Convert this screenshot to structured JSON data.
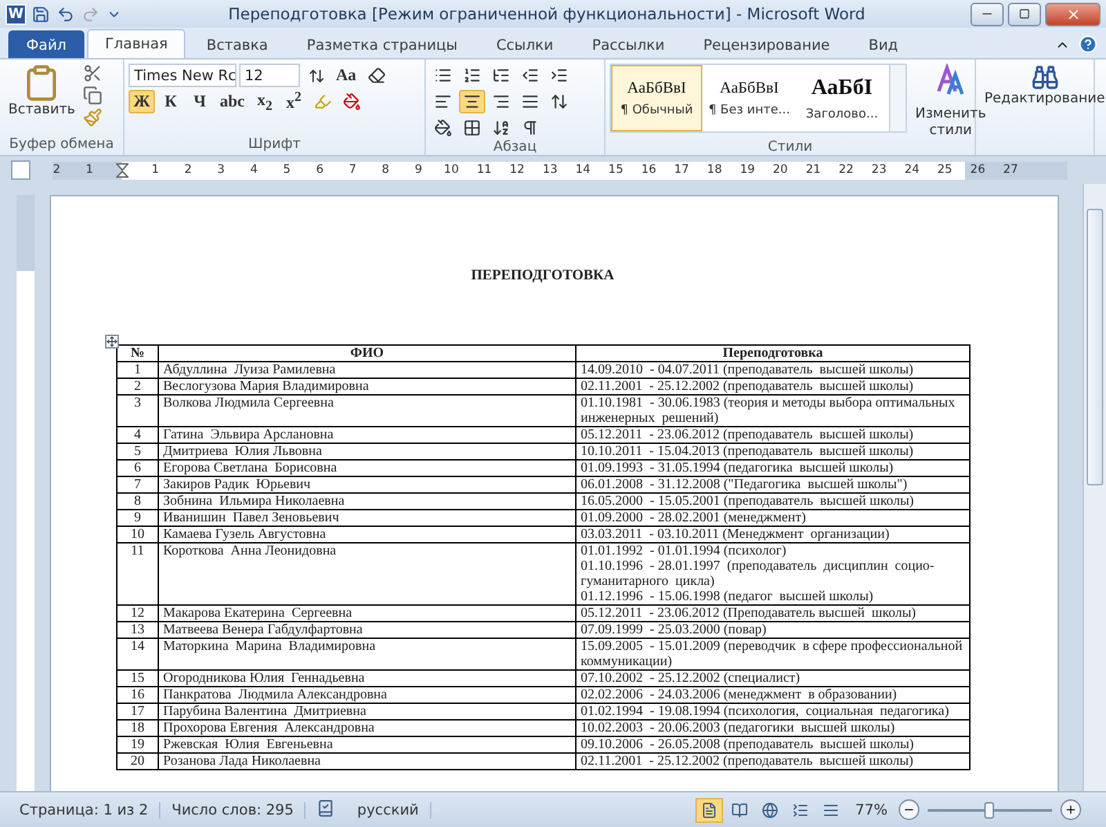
{
  "window": {
    "logo": "W",
    "title": "Переподготовка [Режим ограниченной функциональности]  -  Microsoft Word"
  },
  "tabs": [
    {
      "label": "Файл",
      "kind": "file",
      "selected": false
    },
    {
      "label": "Главная",
      "kind": "tab",
      "selected": true
    },
    {
      "label": "Вставка",
      "kind": "tab",
      "selected": false
    },
    {
      "label": "Разметка страницы",
      "kind": "tab",
      "selected": false
    },
    {
      "label": "Ссылки",
      "kind": "tab",
      "selected": false
    },
    {
      "label": "Рассылки",
      "kind": "tab",
      "selected": false
    },
    {
      "label": "Рецензирование",
      "kind": "tab",
      "selected": false
    },
    {
      "label": "Вид",
      "kind": "tab",
      "selected": false
    }
  ],
  "ribbon": {
    "clipboard": {
      "paste_label": "Вставить",
      "group_label": "Буфер обмена"
    },
    "font": {
      "font_name": "Times New Rc",
      "font_size": "12",
      "change_case": "Aa",
      "group_label": "Шрифт",
      "format_buttons": [
        {
          "label": "Ж",
          "selected": true
        },
        {
          "label": "К",
          "selected": false
        },
        {
          "label": "Ч",
          "selected": false
        },
        {
          "label": "abc",
          "selected": false
        },
        {
          "label": "x$_{2}$",
          "selected": false
        },
        {
          "label": "x$^{2}$",
          "selected": false
        }
      ]
    },
    "paragraph": {
      "group_label": "Абзац",
      "align": [
        {
          "kind": "left",
          "selected": false
        },
        {
          "kind": "center",
          "selected": true
        },
        {
          "kind": "right",
          "selected": false
        },
        {
          "kind": "justify",
          "selected": false
        }
      ]
    },
    "styles": {
      "group_label": "Стили",
      "items": [
        {
          "preview": "АаБбВвI",
          "label": "¶ Обычный",
          "selected": true
        },
        {
          "preview": "АаБбВвI",
          "label": "¶ Без инте...",
          "selected": false
        },
        {
          "preview": "АаБбI",
          "label": "Заголово...",
          "selected": false,
          "kind": "heading"
        }
      ],
      "change_styles": [
        "Изменить",
        "стили"
      ]
    },
    "editing": {
      "label": "Редактирование"
    }
  },
  "ruler": {
    "left_labels": [
      "2",
      "1"
    ],
    "labels": [
      "1",
      "2",
      "3",
      "4",
      "5",
      "6",
      "7",
      "8",
      "9",
      "10",
      "11",
      "12",
      "13",
      "14",
      "15",
      "16",
      "17",
      "18",
      "19",
      "20",
      "21",
      "22",
      "23",
      "24",
      "25",
      "26",
      "27"
    ]
  },
  "document": {
    "title": "ПЕРЕПОДГОТОВКА",
    "table": {
      "columns": [
        "№",
        "ФИО",
        "Переподготовка"
      ],
      "rows": [
        {
          "num": "1",
          "name": "Абдуллина  Луиза Рамилевна",
          "training": [
            "14.09.2010  - 04.07.2011 (преподаватель  высшей школы)"
          ]
        },
        {
          "num": "2",
          "name": "Веслогузова Мария Владимировна",
          "training": [
            "02.11.2001  - 25.12.2002 (преподаватель  высшей школы)"
          ]
        },
        {
          "num": "3",
          "name": "Волкова Людмила Сергеевна",
          "training": [
            "01.10.1981  - 30.06.1983 (теория и методы выбора оптимальных инженерных  решений)"
          ]
        },
        {
          "num": "4",
          "name": "Гатина  Эльвира Арслановна",
          "training": [
            "05.12.2011  - 23.06.2012 (преподаватель  высшей школы)"
          ]
        },
        {
          "num": "5",
          "name": "Дмитриева  Юлия Львовна",
          "training": [
            "10.10.2011  - 15.04.2013 (преподаватель  высшей школы)"
          ]
        },
        {
          "num": "6",
          "name": "Егорова Светлана  Борисовна",
          "training": [
            "01.09.1993  - 31.05.1994 (педагогика  высшей школы)"
          ]
        },
        {
          "num": "7",
          "name": "Закиров Радик  Юрьевич",
          "training": [
            "06.01.2008  - 31.12.2008 (\"Педагогика  высшей школы\")"
          ]
        },
        {
          "num": "8",
          "name": "Зобнина  Ильмира Николаевна",
          "training": [
            "16.05.2000  - 15.05.2001 (преподаватель  высшей школы)"
          ]
        },
        {
          "num": "9",
          "name": "Иванишин  Павел Зеновьевич",
          "training": [
            "01.09.2000  - 28.02.2001 (менеджмент)"
          ]
        },
        {
          "num": "10",
          "name": "Камаева Гузель Августовна",
          "training": [
            "03.03.2011  - 03.10.2011 (Менеджмент  организации)"
          ]
        },
        {
          "num": "11",
          "name": "Короткова  Анна Леонидовна",
          "training": [
            "01.01.1992  - 01.01.1994 (психолог)",
            "01.10.1996  - 28.01.1997  (преподаватель  дисциплин  социо-гуманитарного  цикла)",
            "01.12.1996  - 15.06.1998 (педагог  высшей школы)"
          ]
        },
        {
          "num": "12",
          "name": "Макарова Екатерина  Сергеевна",
          "training": [
            "05.12.2011  - 23.06.2012 (Преподаватель высшей  школы)"
          ]
        },
        {
          "num": "13",
          "name": "Матвеева Венера Габдулфартовна",
          "training": [
            "07.09.1999  - 25.03.2000 (повар)"
          ]
        },
        {
          "num": "14",
          "name": "Маторкина  Марина  Владимировна",
          "training": [
            "15.09.2005  - 15.01.2009 (переводчик  в сфере профессиональной коммуникации)"
          ]
        },
        {
          "num": "15",
          "name": "Огородникова Юлия  Геннадьевна",
          "training": [
            "07.10.2002  - 25.12.2002 (специалист)"
          ]
        },
        {
          "num": "16",
          "name": "Панкратова  Людмила Александровна",
          "training": [
            "02.02.2006  - 24.03.2006 (менеджмент  в образовании)"
          ]
        },
        {
          "num": "17",
          "name": "Парубина Валентина  Дмитриевна",
          "training": [
            "01.02.1994  - 19.08.1994 (психология,  социальная  педагогика)"
          ]
        },
        {
          "num": "18",
          "name": "Прохорова Евгения  Александровна",
          "training": [
            "10.02.2003  - 20.06.2003 (педагогики  высшей школы)"
          ]
        },
        {
          "num": "19",
          "name": "Ржевская  Юлия  Евгеньевна",
          "training": [
            "09.10.2006  - 26.05.2008 (преподаватель  высшей школы)"
          ]
        },
        {
          "num": "20",
          "name": "Розанова Лада Николаевна",
          "training": [
            "02.11.2001  - 25.12.2002 (преподаватель  высшей школы)"
          ]
        }
      ]
    }
  },
  "status_bar": {
    "page": "Страница: 1 из 2",
    "words": "Число слов: 295",
    "language": "русский",
    "zoom": "77%",
    "views": [
      {
        "kind": "print",
        "selected": true
      },
      {
        "kind": "read",
        "selected": false
      },
      {
        "kind": "web",
        "selected": false
      },
      {
        "kind": "outline",
        "selected": false
      },
      {
        "kind": "draft",
        "selected": false
      }
    ],
    "zoom_slider": {
      "level": 0.5
    }
  }
}
